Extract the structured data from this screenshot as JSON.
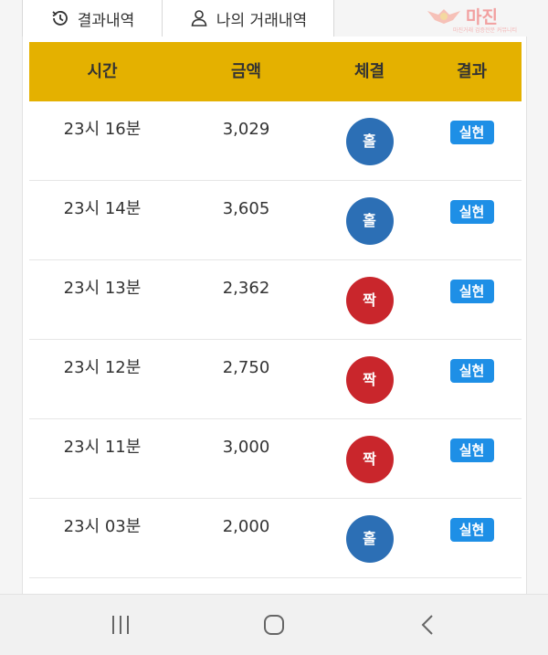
{
  "tabs": {
    "results_label": "결과내역",
    "my_label": "나의 거래내역"
  },
  "logo": {
    "text": "마진",
    "sub": "마진거래 검증전문 커뮤니티"
  },
  "table": {
    "headers": {
      "time": "시간",
      "amount": "금액",
      "trade": "체결",
      "result": "결과"
    },
    "rows": [
      {
        "time": "23시 16분",
        "amount": "3,029",
        "trade": "홀",
        "trade_type": "hol",
        "result": "실현"
      },
      {
        "time": "23시 14분",
        "amount": "3,605",
        "trade": "홀",
        "trade_type": "hol",
        "result": "실현"
      },
      {
        "time": "23시 13분",
        "amount": "2,362",
        "trade": "짝",
        "trade_type": "jjak",
        "result": "실현"
      },
      {
        "time": "23시 12분",
        "amount": "2,750",
        "trade": "짝",
        "trade_type": "jjak",
        "result": "실현"
      },
      {
        "time": "23시 11분",
        "amount": "3,000",
        "trade": "짝",
        "trade_type": "jjak",
        "result": "실현"
      },
      {
        "time": "23시 03분",
        "amount": "2,000",
        "trade": "홀",
        "trade_type": "hol",
        "result": "실현"
      }
    ]
  },
  "colors": {
    "header_bg": "#e4b100",
    "hol": "#2c6fb5",
    "jjak": "#c9262c",
    "badge": "#1e8fe6"
  },
  "icons": {
    "results_tab": "history-icon",
    "my_tab": "user-icon",
    "nav_recent": "recent-apps-icon",
    "nav_home": "home-icon",
    "nav_back": "back-icon"
  }
}
